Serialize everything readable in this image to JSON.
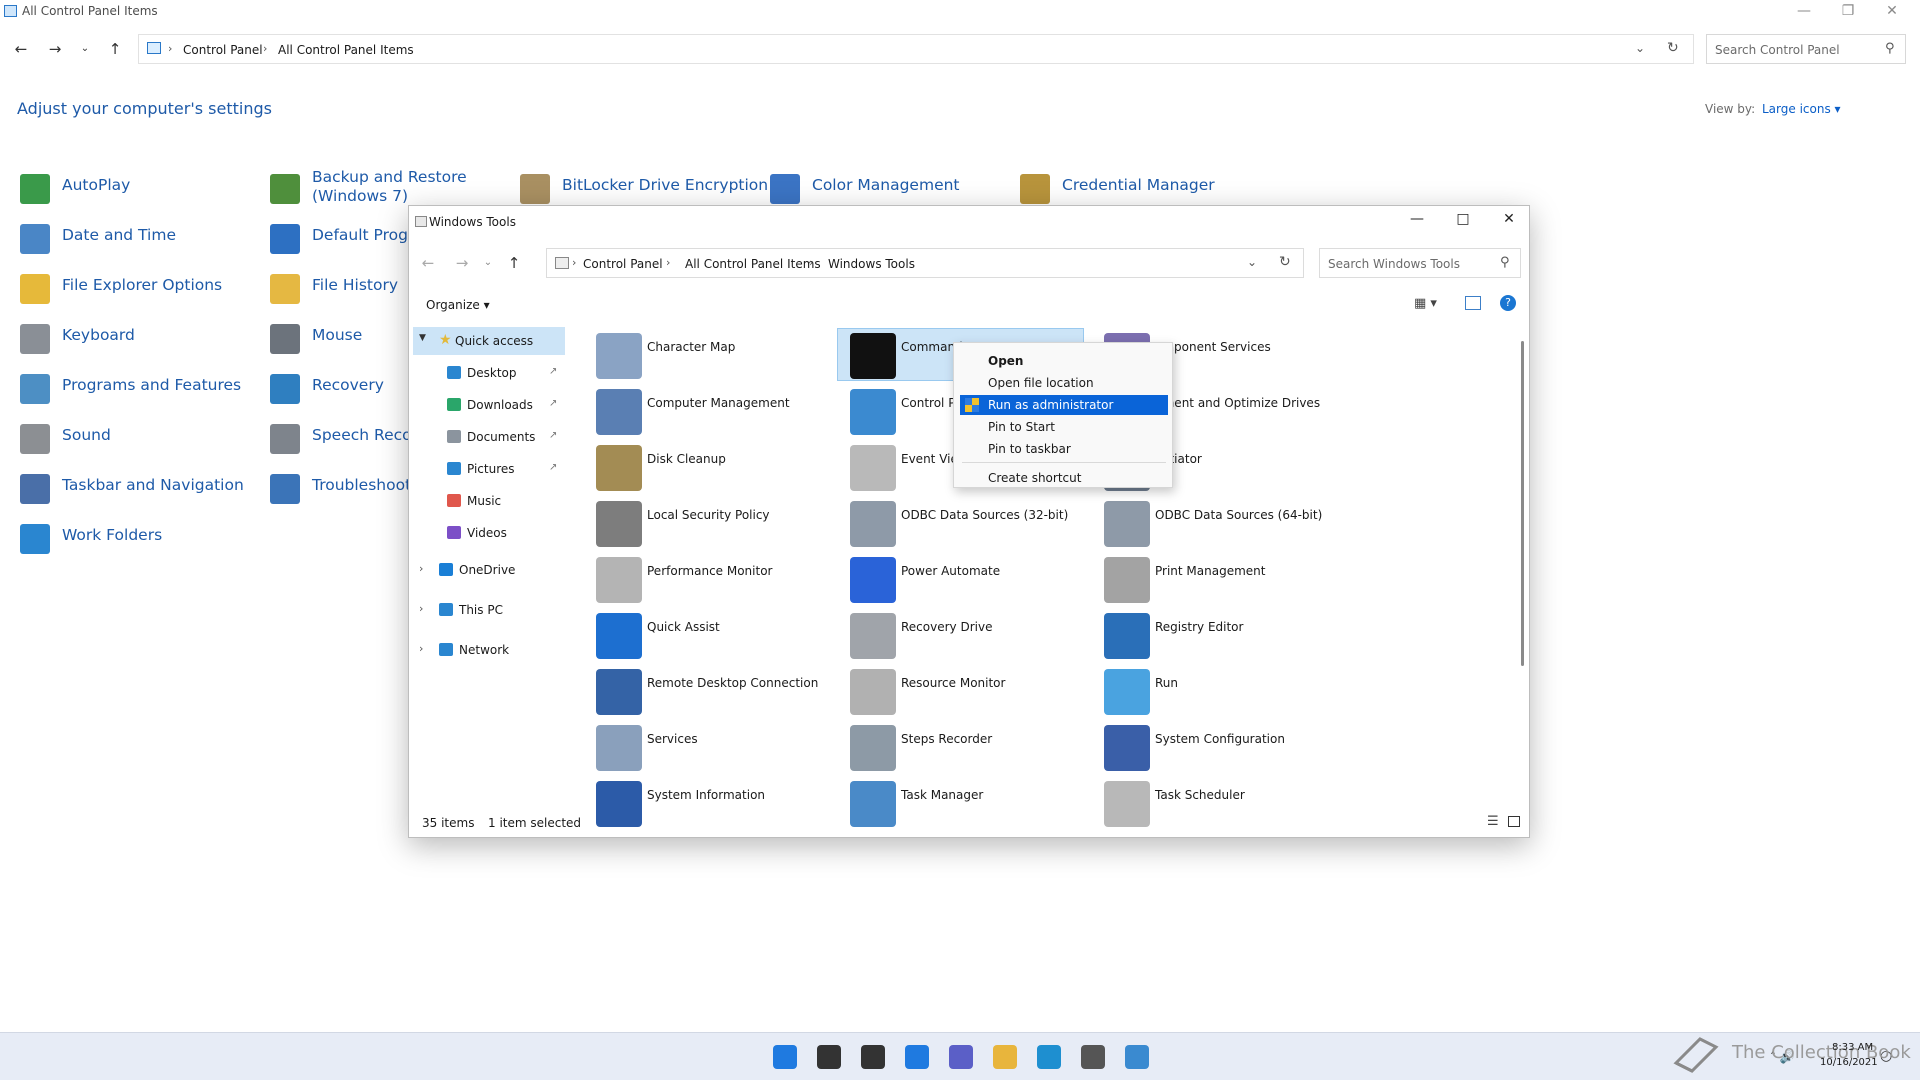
{
  "control_panel": {
    "title": "All Control Panel Items",
    "breadcrumb": [
      "Control Panel",
      "All Control Panel Items"
    ],
    "search_placeholder": "Search Control Panel",
    "heading": "Adjust your computer's settings",
    "view_by_label": "View by:",
    "view_by_value": "Large icons",
    "items": [
      {
        "label": "AutoPlay",
        "icon": "autoplay-icon",
        "color": "#3a9a4a"
      },
      {
        "label": "Backup and Restore\n(Windows 7)",
        "icon": "backup-icon",
        "color": "#4f8f3c"
      },
      {
        "label": "BitLocker Drive Encryption",
        "icon": "bitlocker-icon",
        "color": "#a99062"
      },
      {
        "label": "Color Management",
        "icon": "color-management-icon",
        "color": "#3b74c4"
      },
      {
        "label": "Credential Manager",
        "icon": "credential-icon",
        "color": "#b8943c"
      },
      {
        "label": "Date and Time",
        "icon": "clock-icon",
        "color": "#4a86c6"
      },
      {
        "label": "Default Progra",
        "icon": "default-programs-icon",
        "color": "#2d70c2"
      },
      {
        "label": "File Explorer Options",
        "icon": "folder-options-icon",
        "color": "#e6b93a"
      },
      {
        "label": "File History",
        "icon": "file-history-icon",
        "color": "#e5b842"
      },
      {
        "label": "Keyboard",
        "icon": "keyboard-icon",
        "color": "#8a8f96"
      },
      {
        "label": "Mouse",
        "icon": "mouse-icon",
        "color": "#6c737c"
      },
      {
        "label": "Programs and Features",
        "icon": "programs-icon",
        "color": "#4d8fc4"
      },
      {
        "label": "Recovery",
        "icon": "recovery-icon",
        "color": "#2f7fc0"
      },
      {
        "label": "Sound",
        "icon": "sound-icon",
        "color": "#8c8f93"
      },
      {
        "label": "Speech Recog",
        "icon": "microphone-icon",
        "color": "#7e848c"
      },
      {
        "label": "Taskbar and Navigation",
        "icon": "taskbar-icon",
        "color": "#4a6fa8"
      },
      {
        "label": "Troubleshooti",
        "icon": "troubleshoot-icon",
        "color": "#3b74b8"
      },
      {
        "label": "Work Folders",
        "icon": "work-folders-icon",
        "color": "#2a86d0"
      }
    ]
  },
  "windows_tools": {
    "title": "Windows Tools",
    "breadcrumb": [
      "Control Panel",
      "All Control Panel Items",
      "Windows Tools"
    ],
    "search_placeholder": "Search Windows Tools",
    "organize_label": "Organize",
    "nav": {
      "quick_access": "Quick access",
      "pinned": [
        "Desktop",
        "Downloads",
        "Documents",
        "Pictures"
      ],
      "unpinned": [
        "Music",
        "Videos"
      ],
      "roots": [
        "OneDrive",
        "This PC",
        "Network"
      ]
    },
    "tools": [
      {
        "label": "Character Map",
        "icon": "character-map-icon",
        "color": "#8aa3c4"
      },
      {
        "label": "Command P",
        "icon": "command-prompt-icon",
        "color": "#111111"
      },
      {
        "label": "omponent Services",
        "icon": "component-services-icon",
        "color": "#7c6fb0"
      },
      {
        "label": "Computer Management",
        "icon": "computer-management-icon",
        "color": "#5a7fb3"
      },
      {
        "label": "Control Par",
        "icon": "control-panel-icon",
        "color": "#3b8ad0"
      },
      {
        "label": "gment and Optimize Drives",
        "icon": "defrag-icon",
        "color": "#7c8a99"
      },
      {
        "label": "Disk Cleanup",
        "icon": "disk-cleanup-icon",
        "color": "#a38c54"
      },
      {
        "label": "Event Viewe",
        "icon": "event-viewer-icon",
        "color": "#b9b9b9"
      },
      {
        "label": "Initiator",
        "icon": "iscsi-icon",
        "color": "#6f7e90"
      },
      {
        "label": "Local Security Policy",
        "icon": "security-policy-icon",
        "color": "#7d7d7d"
      },
      {
        "label": "ODBC Data Sources (32-bit)",
        "icon": "odbc32-icon",
        "color": "#8e9aa8"
      },
      {
        "label": "ODBC Data Sources (64-bit)",
        "icon": "odbc64-icon",
        "color": "#8e9aa8"
      },
      {
        "label": "Performance Monitor",
        "icon": "performance-monitor-icon",
        "color": "#b4b4b4"
      },
      {
        "label": "Power Automate",
        "icon": "power-automate-icon",
        "color": "#2a63d8"
      },
      {
        "label": "Print Management",
        "icon": "print-management-icon",
        "color": "#a3a3a3"
      },
      {
        "label": "Quick Assist",
        "icon": "quick-assist-icon",
        "color": "#1d6fd0"
      },
      {
        "label": "Recovery Drive",
        "icon": "recovery-drive-icon",
        "color": "#a0a4aa"
      },
      {
        "label": "Registry Editor",
        "icon": "registry-editor-icon",
        "color": "#2a6fb8"
      },
      {
        "label": "Remote Desktop Connection",
        "icon": "remote-desktop-icon",
        "color": "#3463a6"
      },
      {
        "label": "Resource Monitor",
        "icon": "resource-monitor-icon",
        "color": "#b1b1b1"
      },
      {
        "label": "Run",
        "icon": "run-icon",
        "color": "#4aa3e0"
      },
      {
        "label": "Services",
        "icon": "services-icon",
        "color": "#8aa0bc"
      },
      {
        "label": "Steps Recorder",
        "icon": "steps-recorder-icon",
        "color": "#8d9aa6"
      },
      {
        "label": "System Configuration",
        "icon": "system-configuration-icon",
        "color": "#3a5fa8"
      },
      {
        "label": "System Information",
        "icon": "system-information-icon",
        "color": "#2c5ba8"
      },
      {
        "label": "Task Manager",
        "icon": "task-manager-icon",
        "color": "#4a8ac8"
      },
      {
        "label": "Task Scheduler",
        "icon": "task-scheduler-icon",
        "color": "#b8b8b8"
      }
    ],
    "status_items": "35 items",
    "status_selected": "1 item selected"
  },
  "context_menu": {
    "items": [
      "Open",
      "Open file location",
      "Run as administrator",
      "Pin to Start",
      "Pin to taskbar",
      "Create shortcut"
    ],
    "highlighted": "Run as administrator"
  },
  "taskbar": {
    "icons": [
      "start-icon",
      "search-icon",
      "task-view-icon",
      "widgets-icon",
      "chat-icon",
      "file-explorer-icon",
      "edge-icon",
      "store-icon",
      "control-panel-icon"
    ],
    "time": "8:33 AM",
    "date": "10/16/2021",
    "watermark": "The Collection Book"
  }
}
